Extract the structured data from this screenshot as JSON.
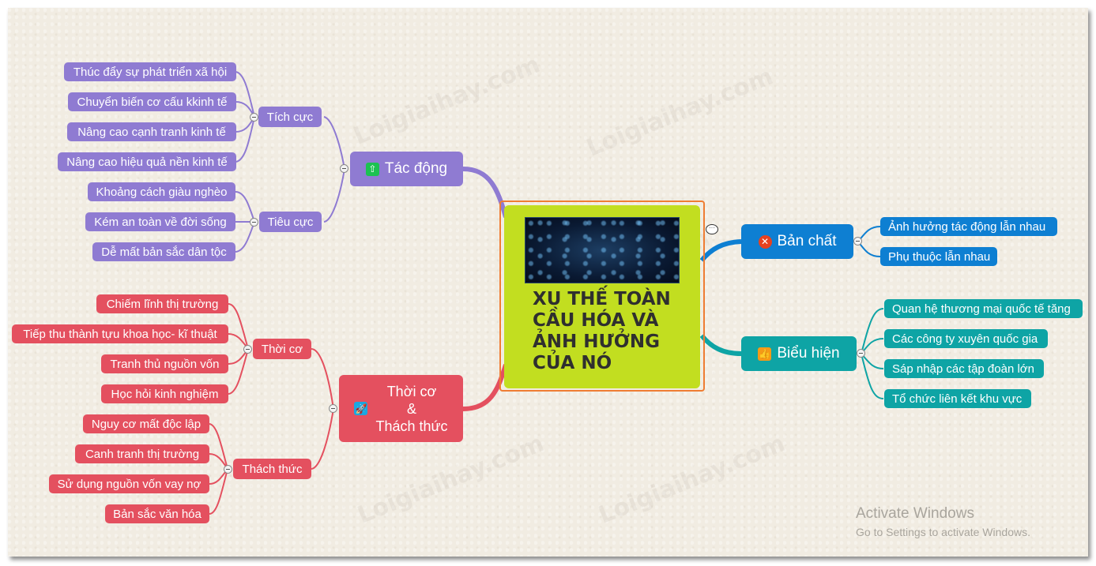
{
  "center": {
    "title": "XU THẾ TOÀN\nCẦU HÓA VÀ\nẢNH HƯỞNG\nCỦA NÓ",
    "image": "world-network-map-image",
    "color": "#c2de20",
    "border_color": "#ef7d33"
  },
  "branches": {
    "tac_dong": {
      "label": "Tác động",
      "icon": "priority-up-icon",
      "color": "#8f7bd2",
      "groups": {
        "tich_cuc": {
          "label": "Tích cực",
          "items": [
            "Thúc đẩy sự phát triển xã hội",
            "Chuyển biến cơ cấu kkinh tế",
            "Nâng cao cạnh tranh kinh tế",
            "Nâng cao hiệu quả nền kinh tế"
          ]
        },
        "tieu_cuc": {
          "label": "Tiêu cực",
          "items": [
            "Khoảng cách giàu nghèo",
            "Kém an toàn về đời sống",
            "Dễ mất bản sắc dân tộc"
          ]
        }
      }
    },
    "thoi_co_thach_thuc": {
      "label_line1": "Thời cơ",
      "label_line2": "&",
      "label_line3": "Thách thức",
      "icon": "rocket-icon",
      "color": "#e4505f",
      "groups": {
        "thoi_co": {
          "label": "Thời cơ",
          "items": [
            "Chiếm lĩnh thị trường",
            "Tiếp thu thành tựu khoa học- kĩ thuật",
            "Tranh thủ nguồn vốn",
            "Học hỏi kinh nghiệm"
          ]
        },
        "thach_thuc": {
          "label": "Thách thức",
          "items": [
            "Nguy cơ mất độc lập",
            "Canh tranh thị trường",
            "Sử dụng nguồn vốn vay nợ",
            "Bản sắc văn hóa"
          ]
        }
      }
    },
    "ban_chat": {
      "label": "Bản chất",
      "icon": "close-circle-icon",
      "color": "#0e7fd2",
      "items": [
        "Ảnh hưởng tác động lẫn nhau",
        "Phụ thuộc lẫn nhau"
      ]
    },
    "bieu_hien": {
      "label": "Biểu hiện",
      "icon": "thumbs-up-icon",
      "color": "#0ea4a5",
      "items": [
        "Quan hệ thương mại quốc tế tăng",
        "Các công ty xuyên quốc gia",
        "Sáp nhập các tập đoàn lớn",
        "Tổ chức liên kết khu vực"
      ]
    }
  },
  "watermark": "Loigiaihay.com",
  "os_overlay": {
    "title": "Activate Windows",
    "subtitle": "Go to Settings to activate Windows."
  }
}
